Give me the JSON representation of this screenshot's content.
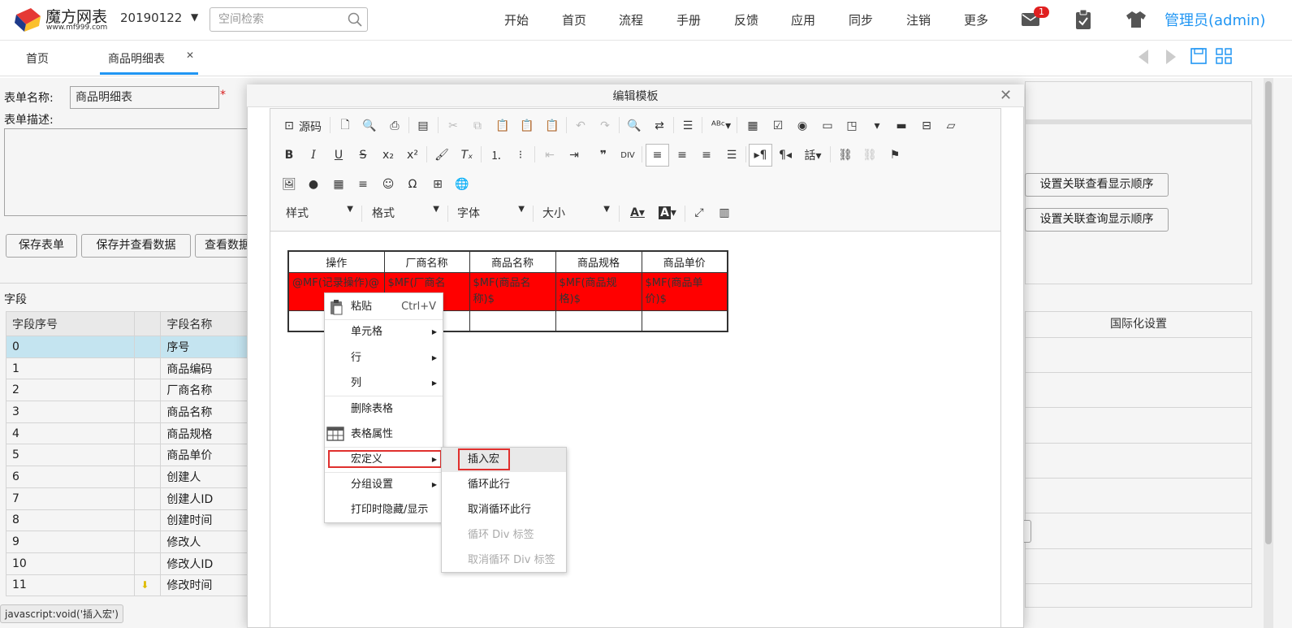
{
  "app": {
    "logo_name": "魔方网表",
    "logo_url": "www.mf999.com",
    "space_id": "20190122",
    "search_placeholder": "空间检索",
    "nav": [
      "开始",
      "首页",
      "流程",
      "手册",
      "反馈",
      "应用",
      "同步",
      "注销",
      "更多"
    ],
    "mail_badge": "1",
    "user": "管理员(admin)"
  },
  "tabs": {
    "home": "首页",
    "active": "商品明细表",
    "close": "✕"
  },
  "form": {
    "name_label": "表单名称:",
    "name_value": "商品明细表",
    "required_mark": "*",
    "desc_label": "表单描述:",
    "buttons": [
      "保存表单",
      "保存并查看数据",
      "查看数据"
    ],
    "fields_title": "字段",
    "fields_headers": [
      "字段序号",
      "",
      "字段名称"
    ],
    "fields": [
      {
        "no": "0",
        "name": "序号"
      },
      {
        "no": "1",
        "name": "商品编码"
      },
      {
        "no": "2",
        "name": "厂商名称"
      },
      {
        "no": "3",
        "name": "商品名称"
      },
      {
        "no": "4",
        "name": "商品规格"
      },
      {
        "no": "5",
        "name": "商品单价"
      },
      {
        "no": "6",
        "name": "创建人"
      },
      {
        "no": "7",
        "name": "创建人ID"
      },
      {
        "no": "8",
        "name": "创建时间"
      },
      {
        "no": "9",
        "name": "修改人"
      },
      {
        "no": "10",
        "name": "修改人ID"
      },
      {
        "no": "11",
        "name": "修改时间"
      }
    ],
    "selected_row": 0,
    "status_url": "javascript:void('插入宏')"
  },
  "right": {
    "btn_view_order": "设置关联查看显示顺序",
    "btn_query_order": "设置关联查询显示顺序",
    "intl_header": "国际化设置"
  },
  "modal": {
    "title": "编辑模板",
    "close": "✕",
    "source_label": "源码",
    "combos": [
      "样式",
      "格式",
      "字体",
      "大小"
    ],
    "table_headers": [
      "操作",
      "厂商名称",
      "商品名称",
      "商品规格",
      "商品单价"
    ],
    "table_macros": [
      "@MF(记录操作)@",
      "$MF(厂商名称)$",
      "$MF(商品名称)$",
      "$MF(商品规格)$",
      "$MF(商品单价)$"
    ]
  },
  "context_menu": {
    "paste": "粘贴",
    "paste_shortcut": "Ctrl+V",
    "cell": "单元格",
    "row": "行",
    "column": "列",
    "delete_table": "删除表格",
    "table_props": "表格属性",
    "macro_define": "宏定义",
    "group_settings": "分组设置",
    "print_toggle": "打印时隐藏/显示"
  },
  "sub_menu": {
    "insert_macro": "插入宏",
    "loop_row": "循环此行",
    "cancel_loop_row": "取消循环此行",
    "loop_div": "循环 Div 标签",
    "cancel_loop_div": "取消循环 Div 标签"
  },
  "colors": {
    "accent": "#2196f3",
    "macro_cell": "#ff0000",
    "highlight_border": "#e0302e",
    "badge": "#e02020"
  }
}
